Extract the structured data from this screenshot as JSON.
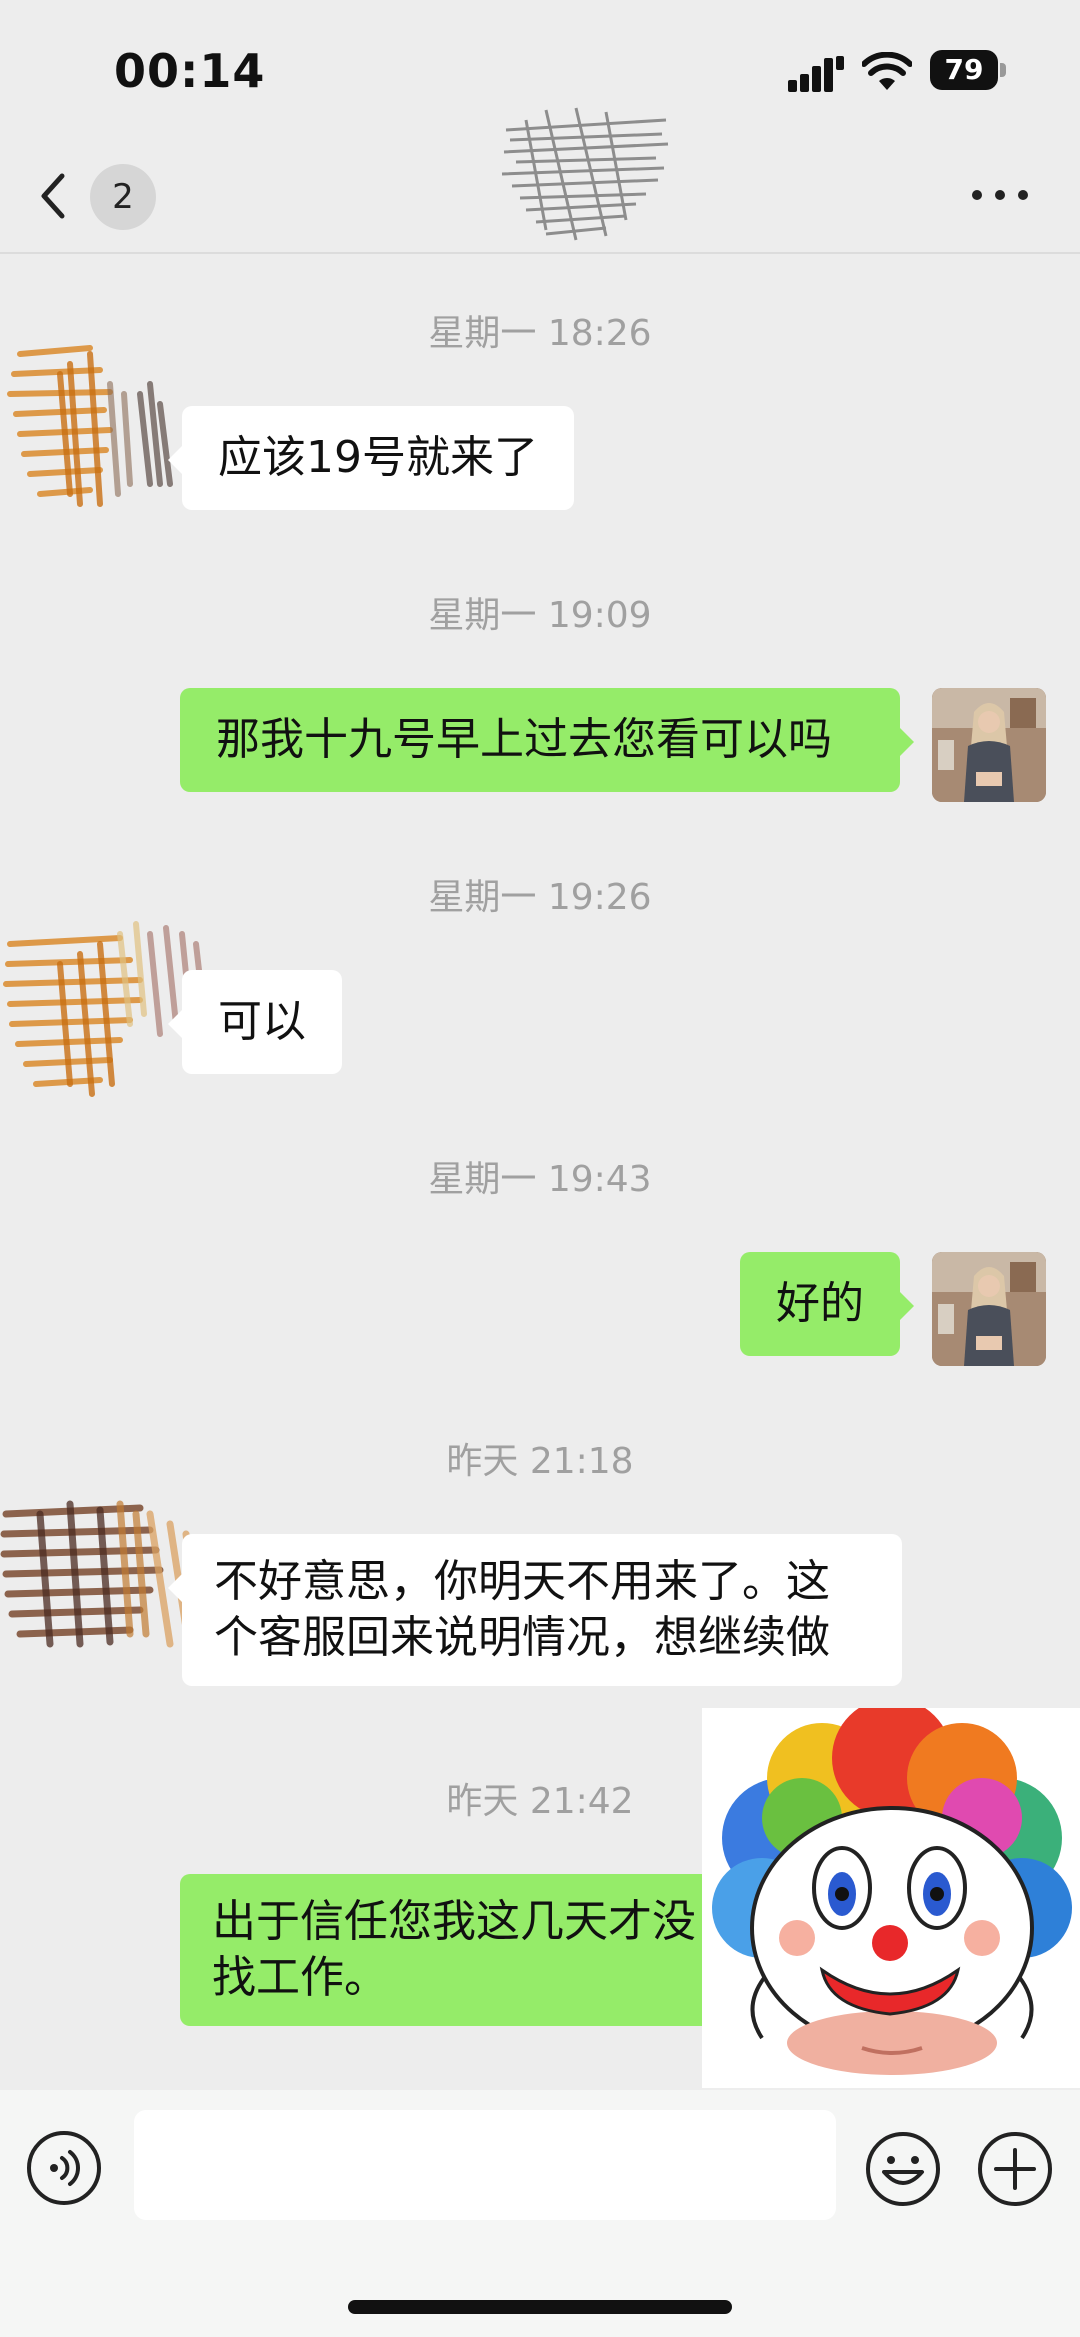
{
  "status_bar": {
    "time": "00:14",
    "battery": "79"
  },
  "nav": {
    "unread_count": "2"
  },
  "messages": [
    {
      "timestamp": "星期一 18:26",
      "direction": "in",
      "text": "应该19号就来了"
    },
    {
      "timestamp": "星期一 19:09",
      "direction": "out",
      "text": "那我十九号早上过去您看可以吗"
    },
    {
      "timestamp": "星期一 19:26",
      "direction": "in",
      "text": "可以"
    },
    {
      "timestamp": "星期一 19:43",
      "direction": "out",
      "text": "好的"
    },
    {
      "timestamp": "昨天 21:18",
      "direction": "in",
      "lines": [
        "不好意思，你明天不用来了。这",
        "个客服回来说明情况，想继续做"
      ]
    },
    {
      "timestamp": "昨天 21:42",
      "direction": "out",
      "lines": [
        "出于信任您我这几天才没",
        "找工作。"
      ]
    }
  ],
  "input": {
    "placeholder": ""
  },
  "colors": {
    "outgoing_bubble": "#95ec69",
    "incoming_bubble": "#ffffff",
    "background": "#ededed"
  }
}
